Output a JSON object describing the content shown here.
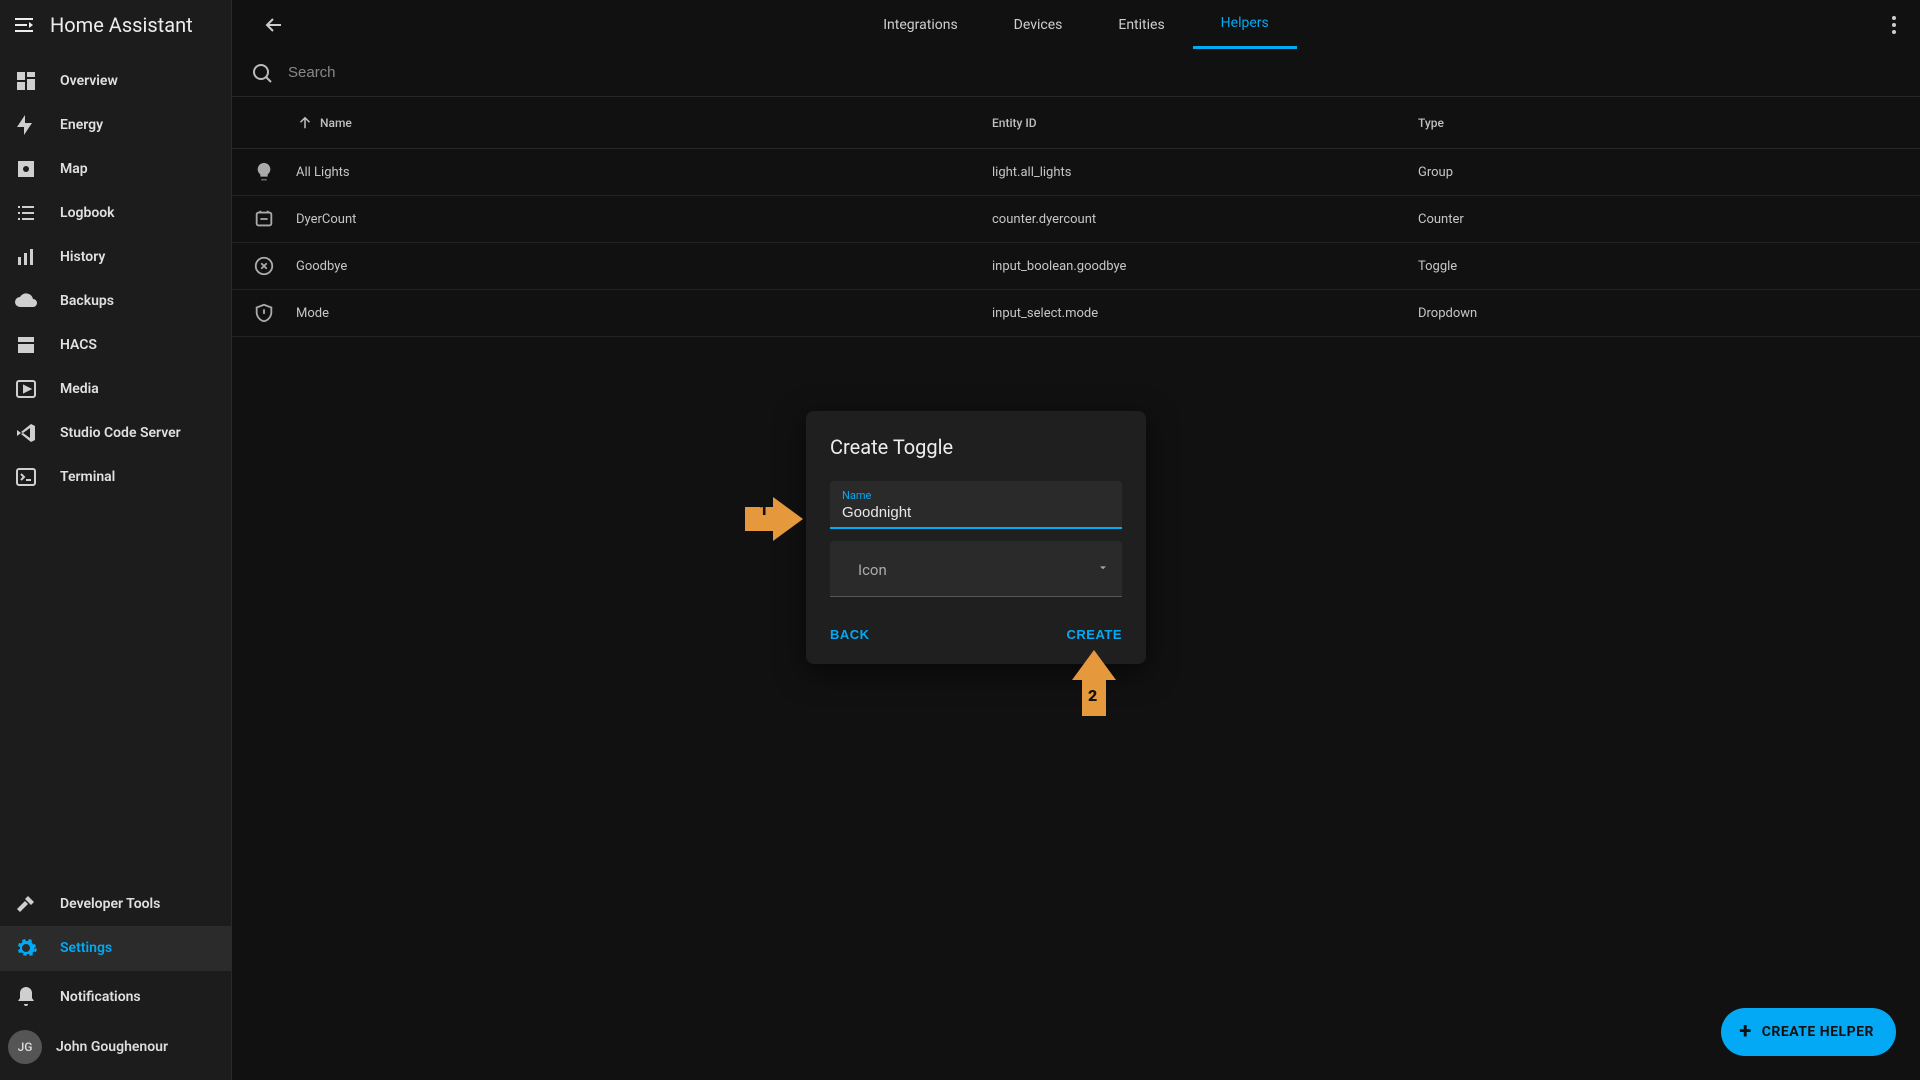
{
  "app": {
    "title": "Home Assistant"
  },
  "sidebar": {
    "items": [
      {
        "label": "Overview"
      },
      {
        "label": "Energy"
      },
      {
        "label": "Map"
      },
      {
        "label": "Logbook"
      },
      {
        "label": "History"
      },
      {
        "label": "Backups"
      },
      {
        "label": "HACS"
      },
      {
        "label": "Media"
      },
      {
        "label": "Studio Code Server"
      },
      {
        "label": "Terminal"
      }
    ],
    "dev": "Developer Tools",
    "settings": "Settings",
    "notifications": "Notifications",
    "user_initials": "JG",
    "user_name": "John Goughenour"
  },
  "tabs": [
    {
      "label": "Integrations"
    },
    {
      "label": "Devices"
    },
    {
      "label": "Entities"
    },
    {
      "label": "Helpers"
    }
  ],
  "search": {
    "placeholder": "Search"
  },
  "columns": {
    "name": "Name",
    "entity": "Entity ID",
    "type": "Type"
  },
  "rows": [
    {
      "name": "All Lights",
      "entity": "light.all_lights",
      "type": "Group"
    },
    {
      "name": "DyerCount",
      "entity": "counter.dyercount",
      "type": "Counter"
    },
    {
      "name": "Goodbye",
      "entity": "input_boolean.goodbye",
      "type": "Toggle"
    },
    {
      "name": "Mode",
      "entity": "input_select.mode",
      "type": "Dropdown"
    }
  ],
  "dialog": {
    "title": "Create Toggle",
    "name_label": "Name",
    "name_value": "Goodnight",
    "icon_label": "Icon",
    "back": "BACK",
    "create": "CREATE"
  },
  "annotations": {
    "arrow1": "1",
    "arrow2": "2"
  },
  "fab": {
    "label": "CREATE HELPER"
  }
}
